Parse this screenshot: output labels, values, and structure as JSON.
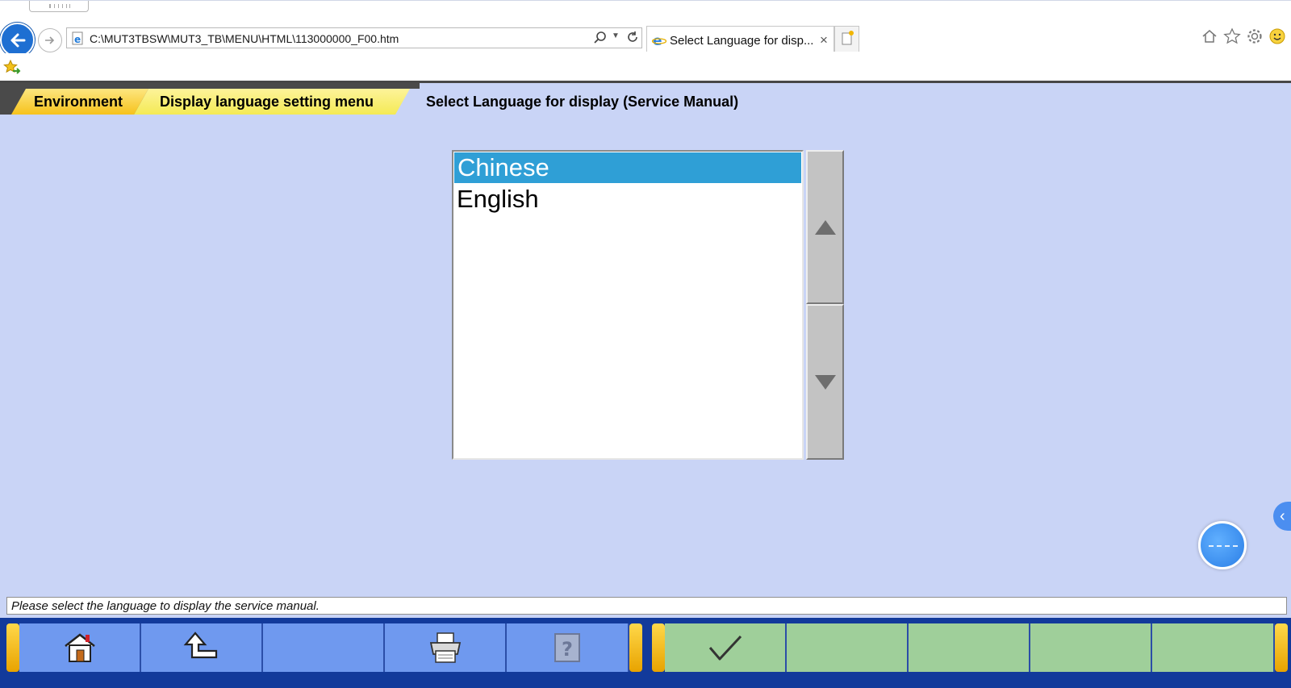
{
  "browser": {
    "url": "C:\\MUT3TBSW\\MUT3_TB\\MENU\\HTML\\113000000_F00.htm",
    "tab_title": "Select Language for disp...",
    "tab_close": "×"
  },
  "breadcrumb": {
    "items": [
      "Environment",
      "Display language setting menu"
    ],
    "current": "Select Language for display (Service Manual)"
  },
  "language_list": {
    "items": [
      {
        "label": "Chinese",
        "selected": true
      },
      {
        "label": "English",
        "selected": false
      }
    ]
  },
  "status": {
    "message": "Please select the language to display the service manual."
  },
  "side_tab": {
    "glyph": "‹"
  },
  "colors": {
    "app_bg": "#c9d4f6",
    "selected_bg": "#2f9fd6",
    "toolbar_bg": "#123a9b",
    "fkey_blue": "#6f99ef",
    "fkey_green": "#9fcf9a",
    "crumb_yellow": "#f6c21c"
  },
  "toolbar": {
    "left_keys": [
      "home-icon",
      "back-up-icon",
      "",
      "printer-icon",
      "help-icon"
    ],
    "right_keys": [
      "checkmark-icon",
      "",
      "",
      "",
      ""
    ]
  }
}
